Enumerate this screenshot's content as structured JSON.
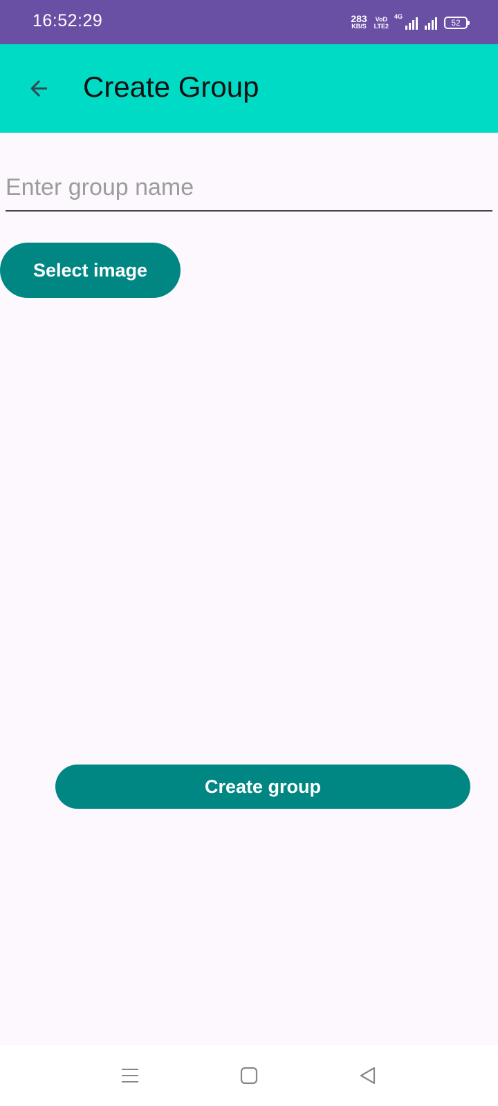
{
  "status_bar": {
    "time": "16:52:29",
    "net_speed_value": "283",
    "net_speed_unit": "KB/S",
    "volte_top": "VoD",
    "volte_bottom": "LTE2",
    "network_type": "4G",
    "battery": "52"
  },
  "app_bar": {
    "title": "Create Group",
    "background": "#00dbc6"
  },
  "form": {
    "group_name_placeholder": "Enter group name",
    "group_name_value": "",
    "select_image_label": "Select image",
    "create_group_label": "Create group",
    "button_color": "#008784"
  },
  "nav_bar": {
    "icons": [
      "menu-icon",
      "home-icon",
      "back-triangle-icon"
    ]
  }
}
